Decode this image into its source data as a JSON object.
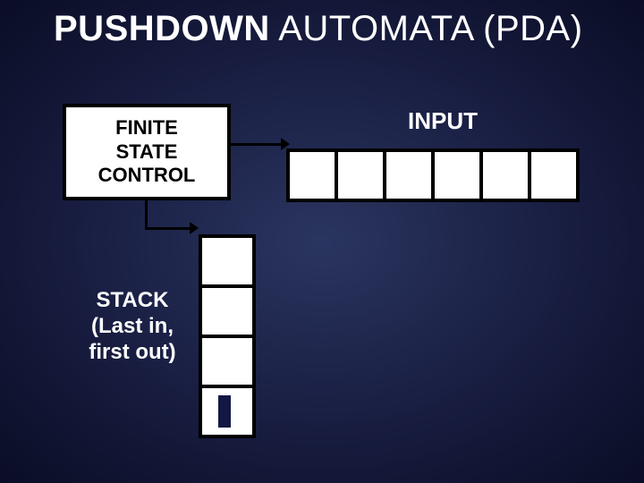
{
  "title_bold": "PUSHDOWN",
  "title_rest": " AUTOMATA (PDA)",
  "finite_state_control": "FINITE\nSTATE\nCONTROL",
  "input_label": "INPUT",
  "stack_label": "STACK\n(Last in,\nfirst out)",
  "tape_cells": 6,
  "stack_cells": 4
}
